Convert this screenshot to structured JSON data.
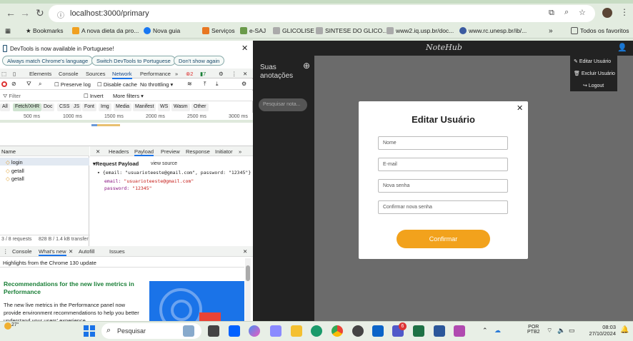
{
  "browser": {
    "url": "localhost:3000/primary",
    "bookmarks": [
      "Bookmarks",
      "A nova dieta da pro...",
      "Nova guia",
      "Serviços",
      "e-SAJ",
      "GLICOLISE",
      "SINTESE DO GLICO...",
      "www2.iq.usp.br/doc...",
      "www.rc.unesp.br/ib/...",
      "Todos os favoritos"
    ]
  },
  "devtools": {
    "banner_text": "DevTools is now available in Portuguese!",
    "banner_buttons": [
      "Always match Chrome's language",
      "Switch DevTools to Portuguese",
      "Don't show again"
    ],
    "tabs": [
      "Elements",
      "Console",
      "Sources",
      "Network",
      "Performance"
    ],
    "badges": {
      "errors": "2",
      "warnings": "7"
    },
    "toolbar": {
      "preserve_log": "Preserve log",
      "disable_cache": "Disable cache",
      "throttling": "No throttling"
    },
    "filter": {
      "placeholder": "Filter",
      "invert": "Invert",
      "more_filters": "More filters"
    },
    "type_chips": [
      "All",
      "Fetch/XHR",
      "Doc",
      "CSS",
      "JS",
      "Font",
      "Img",
      "Media",
      "Manifest",
      "WS",
      "Wasm",
      "Other"
    ],
    "timeline_ticks": [
      "500 ms",
      "1000 ms",
      "1500 ms",
      "2000 ms",
      "2500 ms",
      "3000 ms"
    ],
    "request_list": {
      "header": "Name",
      "items": [
        "login",
        "getall",
        "getall"
      ],
      "status": "3 / 8 requests",
      "size": "828 B / 1.4 kB transfer"
    },
    "detail_tabs": [
      "Headers",
      "Payload",
      "Preview",
      "Response",
      "Initiator"
    ],
    "payload": {
      "title": "Request Payload",
      "view_source": "view source",
      "summary": "{email: \"usuarioteeste@gmail.com\", password: \"12345\"}",
      "email_key": "email:",
      "email_val": "\"usuarioteeste@gmail.com\"",
      "password_key": "password:",
      "password_val": "\"12345\""
    },
    "drawer": {
      "tabs": [
        "Console",
        "What's new",
        "Autofill",
        "Issues"
      ],
      "highlights": "Highlights from the Chrome 130 update",
      "heading": "Recommendations for the new live metrics in Performance",
      "body": "The new live metrics in the Performance panel now provide environment recommendations to help you better understand your users' experience."
    }
  },
  "app": {
    "logo": "NoteHub",
    "sidebar_title": "Suas anotações",
    "search_placeholder": "Pesquisar nota...",
    "menu": [
      "Editar Usuário",
      "Excluir Usuário",
      "Logout"
    ],
    "modal": {
      "title": "Editar Usuário",
      "fields": [
        "Nome",
        "E-mail",
        "Nova senha",
        "Confirmar nova senha"
      ],
      "confirm": "Confirmar"
    }
  },
  "taskbar": {
    "weather": "27°",
    "search": "Pesquisar",
    "lang": "POR",
    "lang2": "PTB2",
    "time": "08:03",
    "date": "27/10/2024",
    "teams_badge": "6"
  },
  "colors": {
    "accent": "#f2a21c",
    "devtools_green": "#1a7f37"
  }
}
